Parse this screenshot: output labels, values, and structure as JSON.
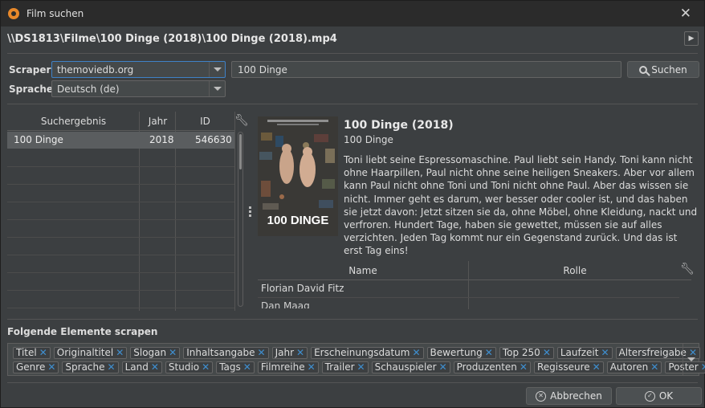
{
  "window": {
    "title": "Film suchen"
  },
  "file_path": "\\\\DS1813\\Filme\\100 Dinge (2018)\\100 Dinge (2018).mp4",
  "scraper": {
    "label": "Scraper",
    "value": "themoviedb.org"
  },
  "language": {
    "label": "Sprache",
    "value": "Deutsch (de)"
  },
  "search": {
    "value": "100 Dinge",
    "button_label": "Suchen"
  },
  "results_table": {
    "columns": [
      "Suchergebnis",
      "Jahr",
      "ID"
    ],
    "rows": [
      {
        "title": "100 Dinge",
        "year": "2018",
        "id": "546630"
      }
    ]
  },
  "details": {
    "title": "100 Dinge (2018)",
    "original_title": "100 Dinge",
    "plot": "Toni liebt seine Espressomaschine. Paul liebt sein Handy. Toni kann nicht ohne Haarpillen, Paul nicht ohne seine heiligen Sneakers. Aber vor allem kann Paul nicht ohne Toni und Toni nicht ohne Paul. Aber das wissen sie nicht. Immer geht es darum, wer besser oder cooler ist, und das haben sie jetzt davon: Jetzt sitzen sie da, ohne Möbel, ohne Kleidung, nackt und verfroren. Hundert Tage, haben sie gewettet, müssen sie auf alles verzichten. Jeden Tag kommt nur ein Gegenstand zurück. Und das ist erst Tag eins!",
    "poster_text": "100 DINGE"
  },
  "cast_table": {
    "columns": [
      "Name",
      "Rolle"
    ],
    "rows": [
      {
        "name": "Florian David Fitz",
        "role": ""
      },
      {
        "name": "Dan Maag",
        "role": ""
      }
    ]
  },
  "scrape_section": {
    "title": "Folgende Elemente scrapen",
    "row1": [
      "Titel",
      "Originaltitel",
      "Slogan",
      "Inhaltsangabe",
      "Jahr",
      "Erscheinungsdatum",
      "Bewertung",
      "Top 250",
      "Laufzeit",
      "Altersfreigabe"
    ],
    "row2": [
      "Genre",
      "Sprache",
      "Land",
      "Studio",
      "Tags",
      "Filmreihe",
      "Trailer",
      "Schauspieler",
      "Produzenten",
      "Regisseure",
      "Autoren",
      "Poster"
    ]
  },
  "buttons": {
    "cancel": "Abbrechen",
    "ok": "OK"
  }
}
